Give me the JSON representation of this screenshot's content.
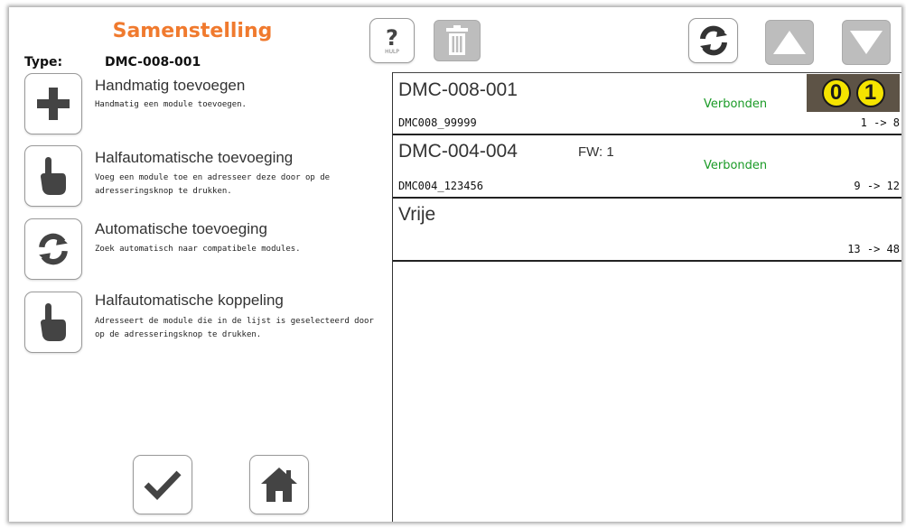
{
  "header": {
    "title": "Samenstelling",
    "type_label": "Type:",
    "type_value": "DMC-008-001",
    "help_label": "HULP"
  },
  "options": [
    {
      "title": "Handmatig toevoegen",
      "description": "Handmatig een module toevoegen.",
      "icon": "plus-icon"
    },
    {
      "title": "Halfautomatische toevoeging",
      "description": "Voeg een module toe en adresseer deze door op de adresseringsknop te drukken.",
      "icon": "hand-pointer-icon"
    },
    {
      "title": "Automatische toevoeging",
      "description": "Zoek automatisch naar compatibele modules.",
      "icon": "refresh-icon"
    },
    {
      "title": "Halfautomatische koppeling",
      "description": "Adresseert de module die in de lijst is geselecteerd door op de adresseringsknop te drukken.",
      "icon": "hand-pointer-icon"
    }
  ],
  "modules": [
    {
      "name": "DMC-008-001",
      "serial": "DMC008_99999",
      "status": "Verbonden",
      "range": "1 -> 8",
      "fw": "",
      "badge": [
        "0",
        "1"
      ]
    },
    {
      "name": "DMC-004-004",
      "serial": "DMC004_123456",
      "status": "Verbonden",
      "range": "9 -> 12",
      "fw": "FW: 1"
    },
    {
      "name": "Vrije",
      "serial": "",
      "status": "",
      "range": "13 -> 48",
      "fw": ""
    }
  ],
  "colors": {
    "title": "#f07a2e",
    "status_connected": "#1a9a26",
    "badge_bg": "#5d5346",
    "badge_digit": "#f5e400",
    "disabled_button": "#bdbdbd"
  }
}
